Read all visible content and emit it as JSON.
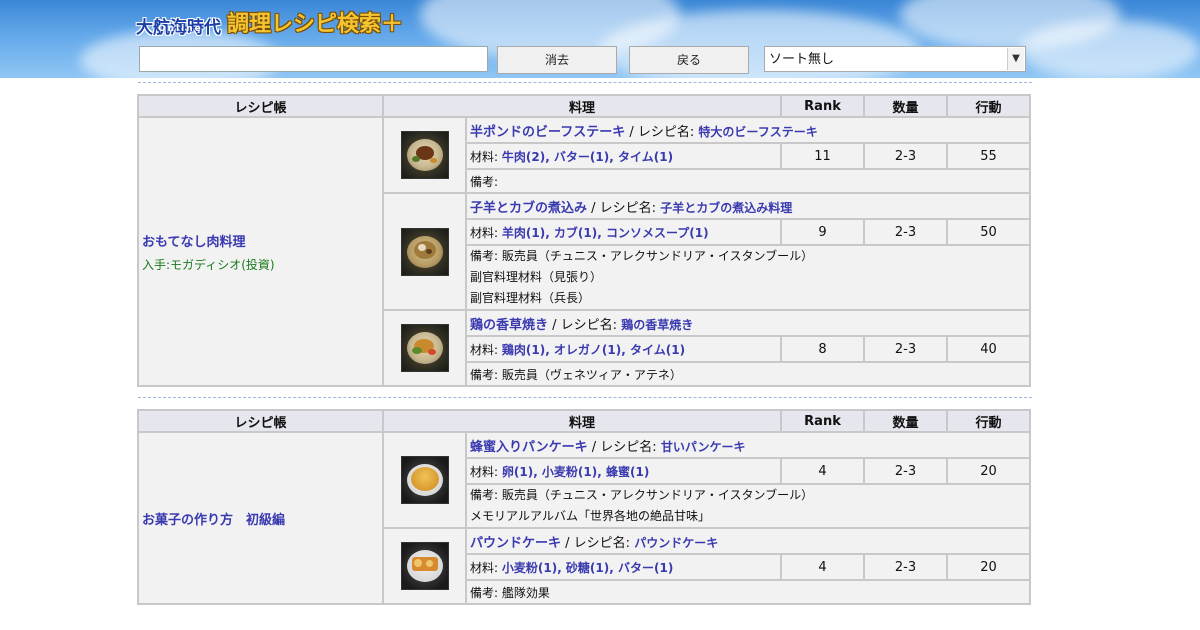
{
  "header": {
    "logo_main": "大航海時代",
    "logo_sub": "Online",
    "logo_title": "調理レシピ検索＋"
  },
  "toolbar": {
    "search_value": "",
    "clear_label": "消去",
    "back_label": "戻る",
    "sort_selected": "ソート無し"
  },
  "table_headers": {
    "book": "レシピ帳",
    "dish": "料理",
    "rank": "Rank",
    "quantity": "数量",
    "action": "行動"
  },
  "labels": {
    "recipe_name_prefix": "/ レシピ名:",
    "materials_prefix": "材料:",
    "notes_prefix": "備考:"
  },
  "groups": [
    {
      "book_name": "おもてなし肉料理",
      "source": "入手:モガディシオ(投資)",
      "dishes": [
        {
          "name": "半ポンドのビーフステーキ",
          "recipe_name": "特大のビーフステーキ",
          "materials": "牛肉(2), バター(1), タイム(1)",
          "rank": "11",
          "quantity": "2-3",
          "action": "55",
          "notes": "",
          "extra_notes": [],
          "image": "steak-dish"
        },
        {
          "name": "子羊とカブの煮込み",
          "recipe_name": "子羊とカブの煮込み料理",
          "materials": "羊肉(1), カブ(1), コンソメスープ(1)",
          "rank": "9",
          "quantity": "2-3",
          "action": "50",
          "notes": "販売員（チュニス・アレクサンドリア・イスタンブール）",
          "extra_notes": [
            "副官料理材料（見張り）",
            "副官料理材料（兵長）"
          ],
          "image": "stew-dish"
        },
        {
          "name": "鶏の香草焼き",
          "recipe_name": "鶏の香草焼き",
          "materials": "鶏肉(1), オレガノ(1), タイム(1)",
          "rank": "8",
          "quantity": "2-3",
          "action": "40",
          "notes": "販売員（ヴェネツィア・アテネ）",
          "extra_notes": [],
          "image": "chicken-dish"
        }
      ]
    },
    {
      "book_name": "お菓子の作り方　初級編",
      "source": "",
      "dishes": [
        {
          "name": "蜂蜜入りパンケーキ",
          "recipe_name": "甘いパンケーキ",
          "materials": "卵(1), 小麦粉(1), 蜂蜜(1)",
          "rank": "4",
          "quantity": "2-3",
          "action": "20",
          "notes": "販売員（チュニス・アレクサンドリア・イスタンブール）",
          "extra_notes": [
            "メモリアルアルバム「世界各地の絶品甘味」"
          ],
          "image": "pancake-dish"
        },
        {
          "name": "パウンドケーキ",
          "recipe_name": "パウンドケーキ",
          "materials": "小麦粉(1), 砂糖(1), バター(1)",
          "rank": "4",
          "quantity": "2-3",
          "action": "20",
          "notes": "艦隊効果",
          "extra_notes": [],
          "image": "poundcake-dish"
        }
      ]
    }
  ],
  "colors": {
    "link": "#3a3ab0",
    "source_green": "#1a7a1a",
    "header_sky": "#3a86d6"
  }
}
